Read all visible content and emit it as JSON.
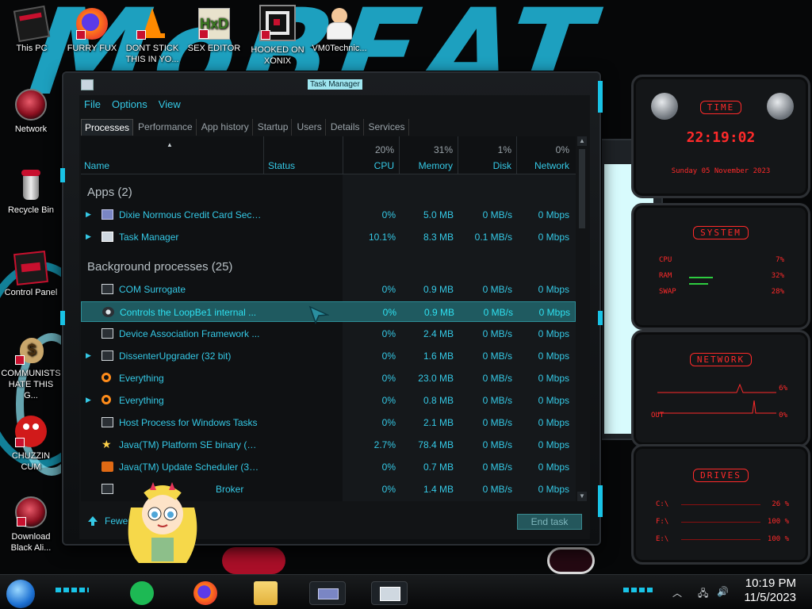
{
  "desktop": {
    "icons": [
      {
        "label": "This PC"
      },
      {
        "label": "FURRY FUX"
      },
      {
        "label": "DONT STICK THIS IN YO..."
      },
      {
        "label": "SEX EDITOR"
      },
      {
        "label": "HOOKED ON XONIX"
      },
      {
        "label": "VM0Technic..."
      },
      {
        "label": "Network"
      },
      {
        "label": "Recycle Bin"
      },
      {
        "label": "Control Panel"
      },
      {
        "label": "COMMUNISTS HATE THIS G..."
      },
      {
        "label": "CHUZZIN CUM"
      },
      {
        "label": "Download Black Ali..."
      }
    ]
  },
  "task_manager": {
    "title": "Task Manager",
    "menu": [
      "File",
      "Options",
      "View"
    ],
    "tabs": [
      "Processes",
      "Performance",
      "App history",
      "Startup",
      "Users",
      "Details",
      "Services"
    ],
    "active_tab": "Processes",
    "columns": {
      "name": "Name",
      "status": "Status",
      "cpu": {
        "label": "CPU",
        "pct": "20%"
      },
      "memory": {
        "label": "Memory",
        "pct": "31%"
      },
      "disk": {
        "label": "Disk",
        "pct": "1%"
      },
      "network": {
        "label": "Network",
        "pct": "0%"
      }
    },
    "groups": {
      "apps": "Apps (2)",
      "background": "Background processes (25)"
    },
    "apps": [
      {
        "name": "Dixie Normous Credit Card Secu...",
        "cpu": "0%",
        "memory": "5.0 MB",
        "disk": "0 MB/s",
        "network": "0 Mbps"
      },
      {
        "name": "Task Manager",
        "cpu": "10.1%",
        "memory": "8.3 MB",
        "disk": "0.1 MB/s",
        "network": "0 Mbps"
      }
    ],
    "background": [
      {
        "name": "COM Surrogate",
        "cpu": "0%",
        "memory": "0.9 MB",
        "disk": "0 MB/s",
        "network": "0 Mbps"
      },
      {
        "name": "Controls the LoopBe1 internal ...",
        "cpu": "0%",
        "memory": "0.9 MB",
        "disk": "0 MB/s",
        "network": "0 Mbps"
      },
      {
        "name": "Device Association Framework ...",
        "cpu": "0%",
        "memory": "2.4 MB",
        "disk": "0 MB/s",
        "network": "0 Mbps"
      },
      {
        "name": "DissenterUpgrader (32 bit)",
        "cpu": "0%",
        "memory": "1.6 MB",
        "disk": "0 MB/s",
        "network": "0 Mbps"
      },
      {
        "name": "Everything",
        "cpu": "0%",
        "memory": "23.0 MB",
        "disk": "0 MB/s",
        "network": "0 Mbps"
      },
      {
        "name": "Everything",
        "cpu": "0%",
        "memory": "0.8 MB",
        "disk": "0 MB/s",
        "network": "0 Mbps"
      },
      {
        "name": "Host Process for Windows Tasks",
        "cpu": "0%",
        "memory": "2.1 MB",
        "disk": "0 MB/s",
        "network": "0 Mbps"
      },
      {
        "name": "Java(TM) Platform SE binary (32...",
        "cpu": "2.7%",
        "memory": "78.4 MB",
        "disk": "0 MB/s",
        "network": "0 Mbps"
      },
      {
        "name": "Java(TM) Update Scheduler (32 ...",
        "cpu": "0%",
        "memory": "0.7 MB",
        "disk": "0 MB/s",
        "network": "0 Mbps"
      },
      {
        "name": "Broker",
        "cpu": "0%",
        "memory": "1.4 MB",
        "disk": "0 MB/s",
        "network": "0 Mbps"
      }
    ],
    "fewer_details": "Fewer d",
    "end_task": "End task"
  },
  "gadgets": {
    "time": {
      "title": "TIME",
      "clock": "22:19:02",
      "date": "Sunday 05 November 2023"
    },
    "system": {
      "title": "SYSTEM",
      "rows": [
        {
          "label": "CPU",
          "value": "7%"
        },
        {
          "label": "RAM",
          "value": "32%"
        },
        {
          "label": "SWAP",
          "value": "28%"
        }
      ]
    },
    "network": {
      "title": "NETWORK",
      "rows": [
        {
          "label": "IN",
          "value": "6%"
        },
        {
          "label": "OUT",
          "value": "0%"
        }
      ]
    },
    "drives": {
      "title": "DRIVES",
      "rows": [
        {
          "label": "C:\\",
          "value": "26 %"
        },
        {
          "label": "F:\\",
          "value": "100 %"
        },
        {
          "label": "E:\\",
          "value": "100 %"
        }
      ]
    }
  },
  "taskbar": {
    "time": "10:19 PM",
    "date": "11/5/2023"
  },
  "colors": {
    "accent": "#35c9e6",
    "alien_red": "#ff2a2a",
    "selected_row": "#1f5a60"
  }
}
